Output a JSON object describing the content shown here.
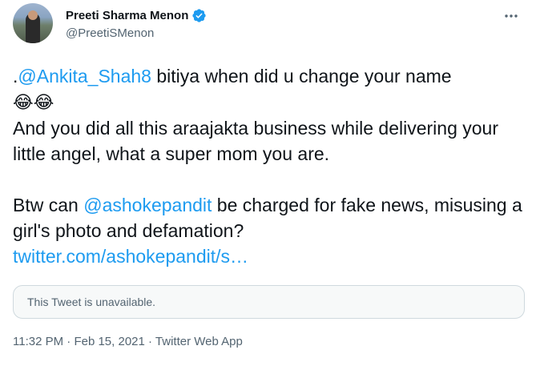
{
  "user": {
    "display_name": "Preeti Sharma Menon",
    "handle": "@PreetiSMenon"
  },
  "tweet": {
    "line1_prefix": ".",
    "mention1": "@Ankita_Shah8",
    "line1_rest": " bitiya when did u change your name",
    "emojis": "😂😂",
    "line2": "And you did all this araajakta business while delivering your little angel, what a super mom you are.",
    "line3_prefix": "Btw can ",
    "mention2": "@ashokepandit",
    "line3_rest": " be charged for fake news, misusing a girl's photo and defamation?",
    "url": "twitter.com/ashokepandit/s…"
  },
  "quote": {
    "unavailable_text": "This Tweet is unavailable."
  },
  "meta": {
    "time": "11:32 PM",
    "separator1": " · ",
    "date": "Feb 15, 2021",
    "separator2": " · ",
    "source": "Twitter Web App"
  },
  "icons": {
    "verified": "verified-badge-icon",
    "more": "more-options-icon"
  },
  "colors": {
    "link": "#1d9bf0",
    "secondary_text": "#536471",
    "primary_text": "#0f1419",
    "border": "#cfd9de"
  }
}
